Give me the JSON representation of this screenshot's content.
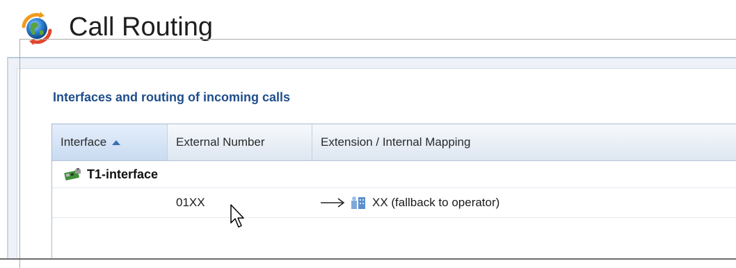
{
  "header": {
    "title": "Call Routing",
    "icon": "call-routing-globe-icon"
  },
  "section": {
    "legend": "Interfaces and routing of incoming calls"
  },
  "grid": {
    "columns": [
      {
        "label": "Interface",
        "sort": "ascending"
      },
      {
        "label": "External Number"
      },
      {
        "label": "Extension / Internal Mapping"
      }
    ],
    "groups": [
      {
        "label": "T1-interface",
        "icon": "t1-interface-card-icon",
        "rows": [
          {
            "interface": "",
            "external_number": "01XX",
            "mapping_arrow": "right-arrow-icon",
            "mapping_icon": "extension-user-icon",
            "mapping": "XX (fallback to operator)"
          }
        ]
      }
    ]
  },
  "colors": {
    "accent": "#1f4e8c",
    "panel_bg": "#eef2f8",
    "header_gradient_top": "#f7f9fc",
    "header_gradient_bottom": "#dde6f1"
  }
}
